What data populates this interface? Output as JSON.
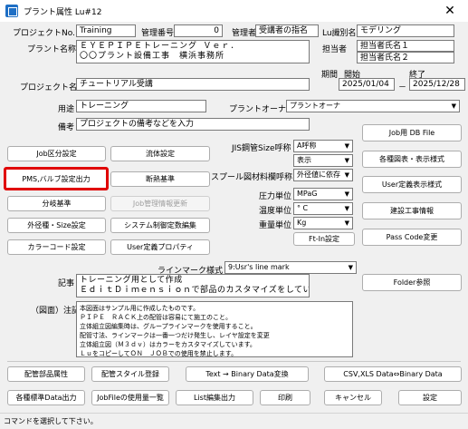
{
  "window": {
    "title": "プラント属性 Lu#12",
    "close_glyph": "✕"
  },
  "row1": {
    "project_no_label": "プロジェクトNo.",
    "project_no_value": "Training",
    "mgmt_no_label": "管理番号",
    "mgmt_no_value": "0",
    "manager_label": "管理者",
    "manager_value": "受講者の指名",
    "alias_label": "Lu識別名",
    "alias_value": "モデリング"
  },
  "plant": {
    "label": "プラント名称",
    "line1": "ＥＹＥＰＩＰＥトレーニング Ｖｅｒ．",
    "line2": "〇〇プラント設備工事　横浜事務所",
    "person_label": "担当者",
    "person1": "担当者氏名１",
    "person2": "担当者氏名２"
  },
  "period": {
    "label": "期間",
    "start_label": "開始",
    "end_label": "終了",
    "start": "2025/01/04",
    "dash": "－",
    "end": "2025/12/28"
  },
  "project_name": {
    "label": "プロジェクト名",
    "value": "チュートリアル受講"
  },
  "usage": {
    "label": "用途",
    "value": "トレーニング",
    "owner_label": "プラントオーナ",
    "owner_value": "プラントオーナ"
  },
  "remarks": {
    "label": "備考",
    "value": "プロジェクトの備考などを入力"
  },
  "left_buttons": {
    "job_division": "Job区分設定",
    "flow": "流体設定",
    "pms": "PMS,バルブ設定出力",
    "insulation": "断熱基準",
    "classification": "分岐基準",
    "job_mgmt": "Job管理情報更新",
    "od_size": "外径種・Size設定",
    "system_ctrl": "システム制御定数編集",
    "color_code": "カラーコード設定",
    "user_prop": "User定義プロパティ"
  },
  "settings": {
    "jis_label": "JIS鋼管Size呼称",
    "jis_value": "A呼称",
    "display_value": "表示",
    "spool_label": "スプール図材料欄呼称",
    "spool_value": "外径値に依存",
    "pressure_label": "圧力単位",
    "pressure_value": "MPaG",
    "temp_label": "温度単位",
    "temp_value": "° C",
    "weight_label": "重量単位",
    "weight_value": "Kg",
    "ftin_button": "Ft-In設定"
  },
  "right_buttons": {
    "job_db": "Job用 DB File",
    "drawing_display": "各種図表・表示様式",
    "user_display": "User定義表示様式",
    "construction": "建設工事情報",
    "pass_code": "Pass Code変更",
    "folder_ref": "Folder参照"
  },
  "line_mark": {
    "label": "ラインマーク様式",
    "value": "9:Usr's line mark"
  },
  "notes": {
    "label": "記事",
    "line1": "トレーニング用として作成",
    "line2": "ＥｄｉｔＤｉｍｅｎｓｉｏｎで部品のカスタマイズをしています。"
  },
  "drawing_notes": {
    "label": "（図面）注記",
    "lines": [
      "本図面はサンプル用に作成したものです。",
      "ＰＩＰＥ　ＲＡＣＫ上の配管は容易にて施工のこと。",
      "立体組立図編集時は、グループラインマークを使用すること。",
      "配管寸法、ラインマークは一番一つだけ発生し、レイヤ設定を変更",
      "立体組立図（Ｍ３ｄｖ）はカラーをカスタマイズしています。",
      "ＬｕをコピーしてＯＮ　ＪＯＢでの使用を禁止します。"
    ]
  },
  "bottom_buttons": {
    "piping_attr": "配管部品属性",
    "piping_style": "配管スタイル登録",
    "text_binary": "Text → Binary Data変換",
    "csv_binary": "CSV,XLS Data⇔Binary Data",
    "std_data": "各種標準Data出力",
    "job_usage": "JobFileの使用量一覧",
    "list_edit": "List編集出力",
    "print": "印刷",
    "cancel": "キャンセル",
    "ok": "設定"
  },
  "status": "コマンドを選択して下さい。"
}
